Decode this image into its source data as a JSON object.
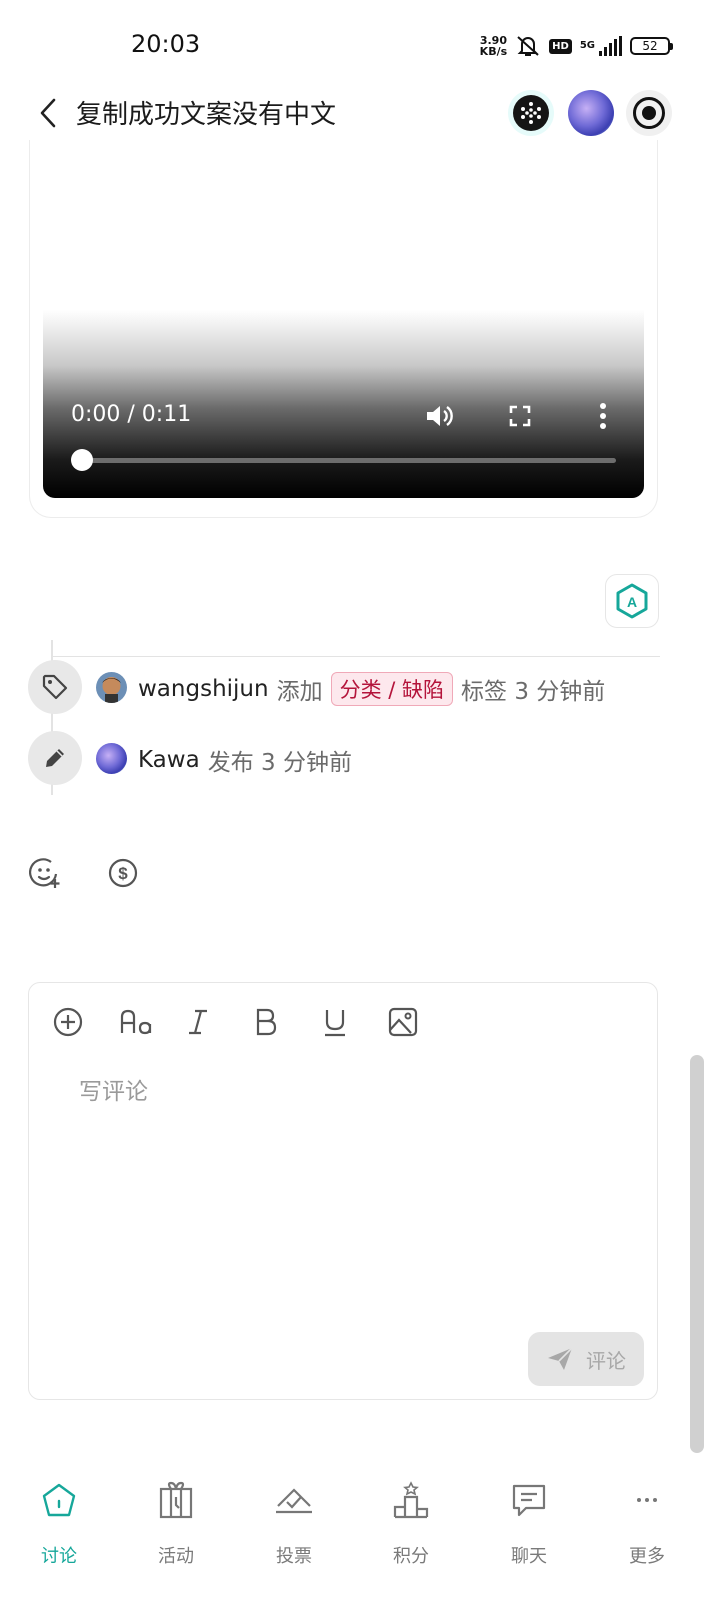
{
  "status_bar": {
    "time": "20:03",
    "net_speed_value": "3.90",
    "net_speed_unit": "KB/s",
    "hd_label": "HD",
    "network": "5G",
    "battery": "52"
  },
  "header": {
    "title": "复制成功文案没有中文"
  },
  "video": {
    "time": "0:00 / 0:11",
    "progress": 0.0
  },
  "timeline": [
    {
      "user": "wangshijun",
      "action": "添加",
      "tag": "分类 / 缺陷",
      "suffix": "标签 3 分钟前"
    },
    {
      "user": "Kawa",
      "action": "发布 3 分钟前"
    }
  ],
  "editor": {
    "placeholder": "写评论",
    "submit_label": "评论"
  },
  "bottom_nav": [
    {
      "label": "讨论",
      "icon": "home-icon",
      "active": true
    },
    {
      "label": "活动",
      "icon": "gift-icon",
      "active": false
    },
    {
      "label": "投票",
      "icon": "vote-icon",
      "active": false
    },
    {
      "label": "积分",
      "icon": "podium-icon",
      "active": false
    },
    {
      "label": "聊天",
      "icon": "chat-icon",
      "active": false
    },
    {
      "label": "更多",
      "icon": "more-icon",
      "active": false
    }
  ],
  "colors": {
    "accent": "#16a79a",
    "tag_text": "#b4143b",
    "tag_bg": "#fde8ed"
  }
}
